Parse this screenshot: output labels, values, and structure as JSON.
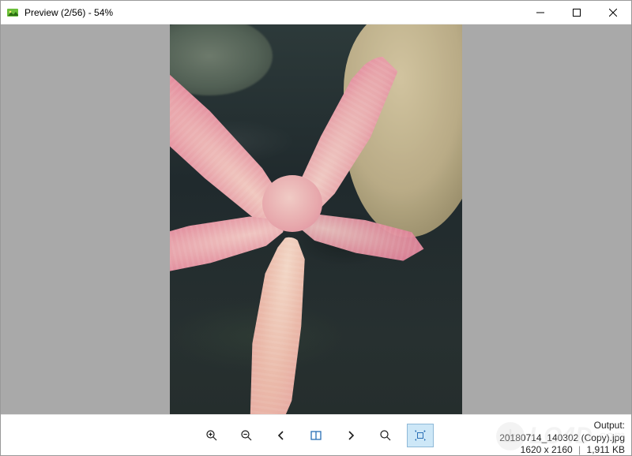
{
  "window": {
    "title": "Preview (2/56) - 54%"
  },
  "toolbar": {
    "zoom_in": "Zoom In",
    "zoom_out": "Zoom Out",
    "prev": "Previous",
    "compare": "Compare",
    "next": "Next",
    "fit": "Fit",
    "actual": "Actual Size"
  },
  "info": {
    "label": "Output:",
    "filename": "20180714_140302 (Copy).jpg",
    "dimensions": "1620 x 2160",
    "filesize": "1,911 KB"
  },
  "watermark": {
    "text": "LO4D"
  },
  "image": {
    "description": "pink starfish in shallow water next to rock"
  }
}
